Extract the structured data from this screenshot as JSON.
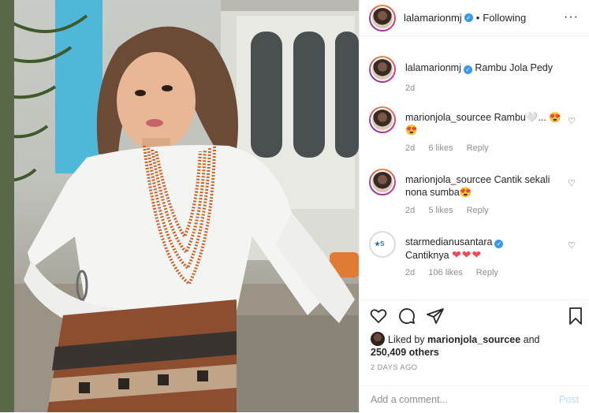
{
  "post": {
    "author": "lalamarionmj",
    "follow_status": "Following",
    "dot": "•",
    "more_icon": "more-horizontal-icon"
  },
  "caption": {
    "username": "lalamarionmj",
    "text": "Rambu Jola Pedy",
    "time": "2d"
  },
  "comments": [
    {
      "username": "marionjola_sourcee",
      "text": "Rambu",
      "emoji": "🤍... 😍😍",
      "time": "2d",
      "likes": "6 likes",
      "reply": "Reply"
    },
    {
      "username": "marionjola_sourcee",
      "text": "Cantik sekali nona sumba😍",
      "time": "2d",
      "likes": "5 likes",
      "reply": "Reply"
    },
    {
      "username": "starmedianusantara",
      "text": "Cantiknya",
      "hearts": "❤❤❤",
      "time": "2d",
      "likes": "106 likes",
      "reply": "Reply"
    }
  ],
  "likes": {
    "prefix": "Liked by",
    "user": "marionjola_sourcee",
    "joiner": "and",
    "others": "250,409 others"
  },
  "timestamp": "2 DAYS AGO",
  "comment_box": {
    "placeholder": "Add a comment...",
    "post_label": "Post"
  },
  "colors": {
    "verified": "#3897f0",
    "heart_red": "#ed4956",
    "muted": "#8e8e8e",
    "post_disabled": "#b2dffc"
  }
}
